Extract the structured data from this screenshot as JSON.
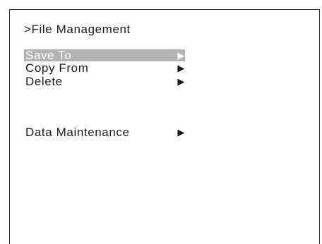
{
  "screen": {
    "title": ">File Management"
  },
  "menu": {
    "items": [
      {
        "label": "Save To",
        "arrow": "▶",
        "selected": true
      },
      {
        "label": "Copy From",
        "arrow": "▶",
        "selected": false
      },
      {
        "label": "Delete",
        "arrow": "▶",
        "selected": false
      },
      {
        "label": "Data Maintenance",
        "arrow": "▶",
        "selected": false
      }
    ]
  },
  "colors": {
    "selection_bg": "#b3b3b3",
    "selection_text": "#ffffff",
    "text": "#1a1a1a",
    "border": "#2a2a2a"
  }
}
